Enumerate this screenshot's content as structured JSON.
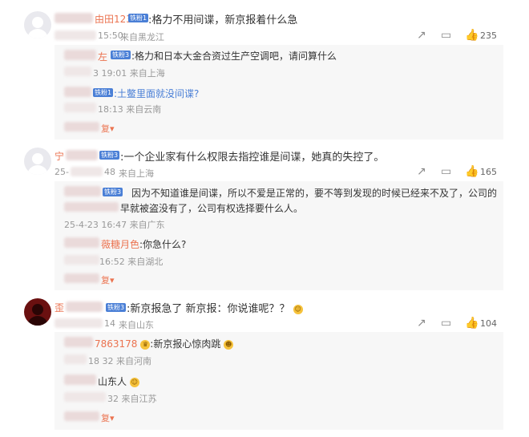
{
  "comments": [
    {
      "name_visible": "由田123",
      "badge": "铁粉1",
      "text": ":格力不用间谍，新京报着什么急",
      "time_visible": "15:50",
      "location": "来自黑龙江",
      "likes": "235",
      "replies": [
        {
          "name_visible": "左",
          "badge": "铁粉3",
          "text": ":格力和日本大金合资过生产空调吧，请问算什么",
          "meta": "3 19:01 来自上海"
        },
        {
          "badge": "铁粉1",
          "text": ":土鳖里面就没间谍?",
          "meta": "18:13 来自云南"
        }
      ],
      "more_visible": "复"
    },
    {
      "name_visible": "宁",
      "badge": "铁粉3",
      "text": ":一个企业家有什么权限去指控谁是间谍，她真的失控了。",
      "time_visible": "25-",
      "time_visible_2": "48",
      "location": "来自上海",
      "likes": "165",
      "replies": [
        {
          "badge": "铁粉3",
          "text_line1": "因为不知道谁是间谍，所以不爱是正常的，要不等到发现的时候已经来不及了，公司的",
          "text_line2": "早就被盗没有了，公司有权选择要什么人。",
          "meta": "25-4-23 16:47 来自广东"
        },
        {
          "name_visible": "薇糖月色",
          "text": ":你急什么?",
          "meta": "16:52 来自湖北"
        }
      ],
      "more_visible": "复"
    },
    {
      "name_visible": "歪",
      "badge": "铁粉3",
      "text": ":新京报急了 新京报：你说谁呢？？",
      "time_visible": "14",
      "location": "来自山东",
      "likes": "104",
      "replies": [
        {
          "name_visible": "7863178",
          "text": ":新京报心惊肉跳",
          "meta": "18 32 来自河南"
        },
        {
          "text": "山东人",
          "meta": "32 来自江苏"
        }
      ],
      "more_visible": "复"
    }
  ],
  "icons": [
    "share-icon",
    "comment-icon",
    "like-icon"
  ]
}
